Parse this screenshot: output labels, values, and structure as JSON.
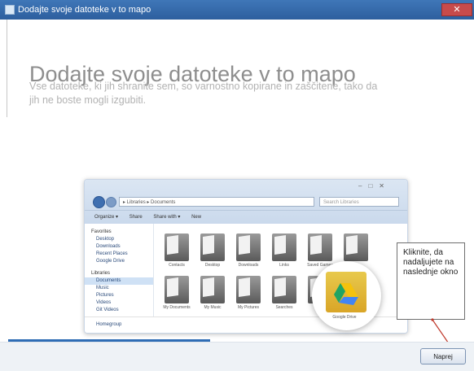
{
  "window": {
    "title": "Dodajte svoje datoteke v to mapo",
    "close_icon": "close-icon"
  },
  "main": {
    "heading": "Dodajte svoje datoteke v to mapo",
    "subtitle": "Vse datoteke, ki jih shranite sem, so varnostno kopirane in zaščitene, tako da jih ne boste mogli izgubiti."
  },
  "explorer_preview": {
    "address": "▸ Libraries ▸ Documents",
    "search_placeholder": "Search Libraries",
    "toolbar": [
      "Organize ▾",
      "Share",
      "Share with ▾",
      "New"
    ],
    "sidebar": {
      "favorites": [
        "Favorites",
        "Desktop",
        "Downloads",
        "Recent Places",
        "Google Drive"
      ],
      "libraries": [
        "Libraries",
        "Documents",
        "Music",
        "Pictures",
        "Videos",
        "Git Videos"
      ],
      "homegroup": "Homegroup"
    },
    "folders_row1": [
      "Contacts",
      "Desktop",
      "Downloads",
      "Links",
      "Saved Games",
      ""
    ],
    "folders_row2": [
      "My Documents",
      "My Music",
      "My Pictures",
      "Searches",
      "",
      ""
    ],
    "drive_label": "Google Drive"
  },
  "callout": {
    "text": "Kliknite, da nadaljujete na naslednje okno"
  },
  "footer": {
    "next_label": "Naprej",
    "progress_percent": 44,
    "accent_color": "#2f6db5"
  }
}
